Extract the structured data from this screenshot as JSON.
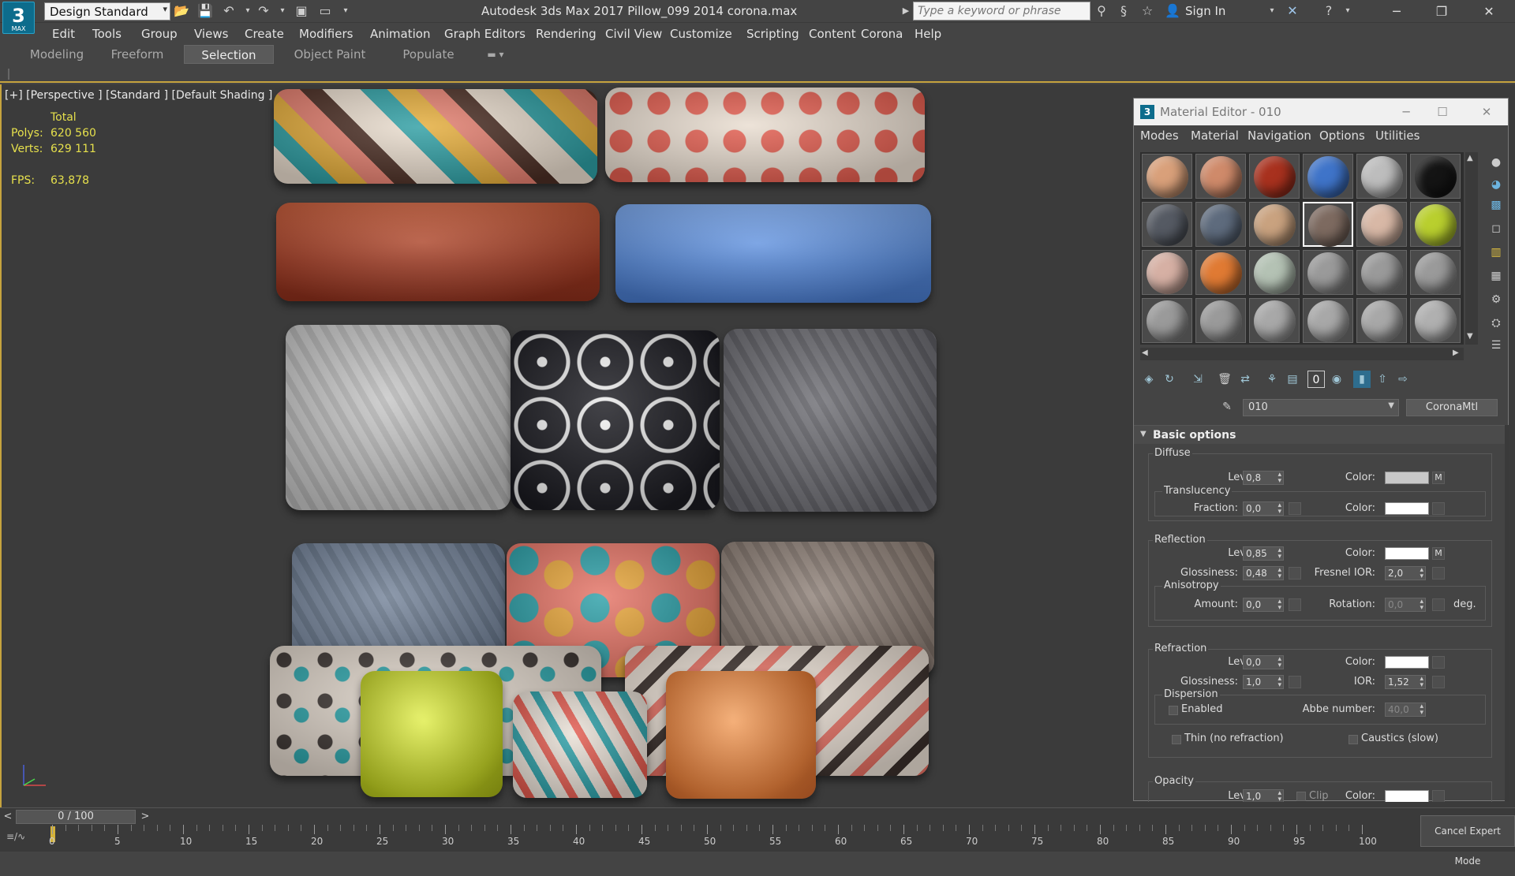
{
  "app": {
    "logo_number": "3",
    "logo_text": "MAX",
    "workspace": "Design Standard",
    "window_title": "Autodesk 3ds Max 2017    Pillow_099  2014 corona.max",
    "search_placeholder": "Type a keyword or phrase",
    "sign_in": "Sign In"
  },
  "menu": [
    "Edit",
    "Tools",
    "Group",
    "Views",
    "Create",
    "Modifiers",
    "Animation",
    "Graph Editors",
    "Rendering",
    "Civil View",
    "Customize",
    "Scripting",
    "Content",
    "Corona",
    "Help"
  ],
  "ribbon_tabs": [
    "Modeling",
    "Freeform",
    "Selection",
    "Object Paint",
    "Populate"
  ],
  "ribbon_active": "Selection",
  "viewport": {
    "label": "[+] [Perspective ] [Standard ] [Default Shading ]",
    "stats": {
      "total_label": "Total",
      "polys_label": "Polys:",
      "polys": "620 560",
      "verts_label": "Verts:",
      "verts": "629 111",
      "fps_label": "FPS:",
      "fps": "63,878"
    },
    "pillow_colors": [
      "#e6d7c8",
      "#e8d6c6",
      "#b44a2c",
      "#5b8fdc",
      "#bcbcbc",
      "#1d1d22",
      "#6c6c72",
      "#6d7d90",
      "#e4c3a0",
      "#8c7d76",
      "#d8cfc4",
      "#c9d935",
      "#e9e0d6",
      "#e47a34",
      "#e8d9cc"
    ]
  },
  "material_editor": {
    "title": "Material Editor - 010",
    "menus": [
      "Modes",
      "Material",
      "Navigation",
      "Options",
      "Utilities"
    ],
    "slot_colors": [
      "#d9a07a",
      "#cf8a6a",
      "#a8311e",
      "#3f74c9",
      "#bdbdbd",
      "#141414",
      "#555a63",
      "#5e6b7d",
      "#c9a27f",
      "#7d6a60",
      "#d8b8a6",
      "#b9cf2e",
      "#d6b0a4",
      "#e07a33",
      "#b4c2b4",
      "#9a9a9a",
      "#9a9a9a",
      "#9a9a9a",
      "#9a9a9a",
      "#9a9a9a",
      "#a8a8a8",
      "#a8a8a8",
      "#a8a8a8",
      "#b0b0b0"
    ],
    "material_name": "010",
    "material_type": "CoronaMtl",
    "rollout_title": "Basic options",
    "diffuse": {
      "group": "Diffuse",
      "level_label": "Level:",
      "level": "0,8",
      "color_label": "Color:",
      "color": "#c8c8c8",
      "map_btn": "M",
      "translucency": "Translucency",
      "fraction_label": "Fraction:",
      "fraction": "0,0",
      "t_color_label": "Color:",
      "t_color": "#ffffff"
    },
    "reflection": {
      "group": "Reflection",
      "level_label": "Level:",
      "level": "0,85",
      "color_label": "Color:",
      "color": "#ffffff",
      "map_btn": "M",
      "glossiness_label": "Glossiness:",
      "glossiness": "0,48",
      "fresnel_label": "Fresnel IOR:",
      "fresnel": "2,0",
      "anisotropy": "Anisotropy",
      "amount_label": "Amount:",
      "amount": "0,0",
      "rotation_label": "Rotation:",
      "rotation": "0,0",
      "deg": "deg."
    },
    "refraction": {
      "group": "Refraction",
      "level_label": "Level:",
      "level": "0,0",
      "color_label": "Color:",
      "color": "#ffffff",
      "glossiness_label": "Glossiness:",
      "glossiness": "1,0",
      "ior_label": "IOR:",
      "ior": "1,52",
      "dispersion": "Dispersion",
      "enabled": "Enabled",
      "abbe_label": "Abbe number:",
      "abbe": "40,0",
      "thin": "Thin (no refraction)",
      "caustics": "Caustics (slow)"
    },
    "opacity": {
      "group": "Opacity",
      "level_label": "Level:",
      "level": "1,0",
      "clip": "Clip",
      "color_label": "Color:",
      "color": "#ffffff"
    }
  },
  "timeline": {
    "slider": "0 / 100",
    "ticks": [
      "0",
      "5",
      "10",
      "15",
      "20",
      "25",
      "30",
      "35",
      "40",
      "45",
      "50",
      "55",
      "60",
      "65",
      "70",
      "75",
      "80",
      "85",
      "90",
      "95",
      "100"
    ],
    "cancel_expert": "Cancel Expert Mode"
  }
}
